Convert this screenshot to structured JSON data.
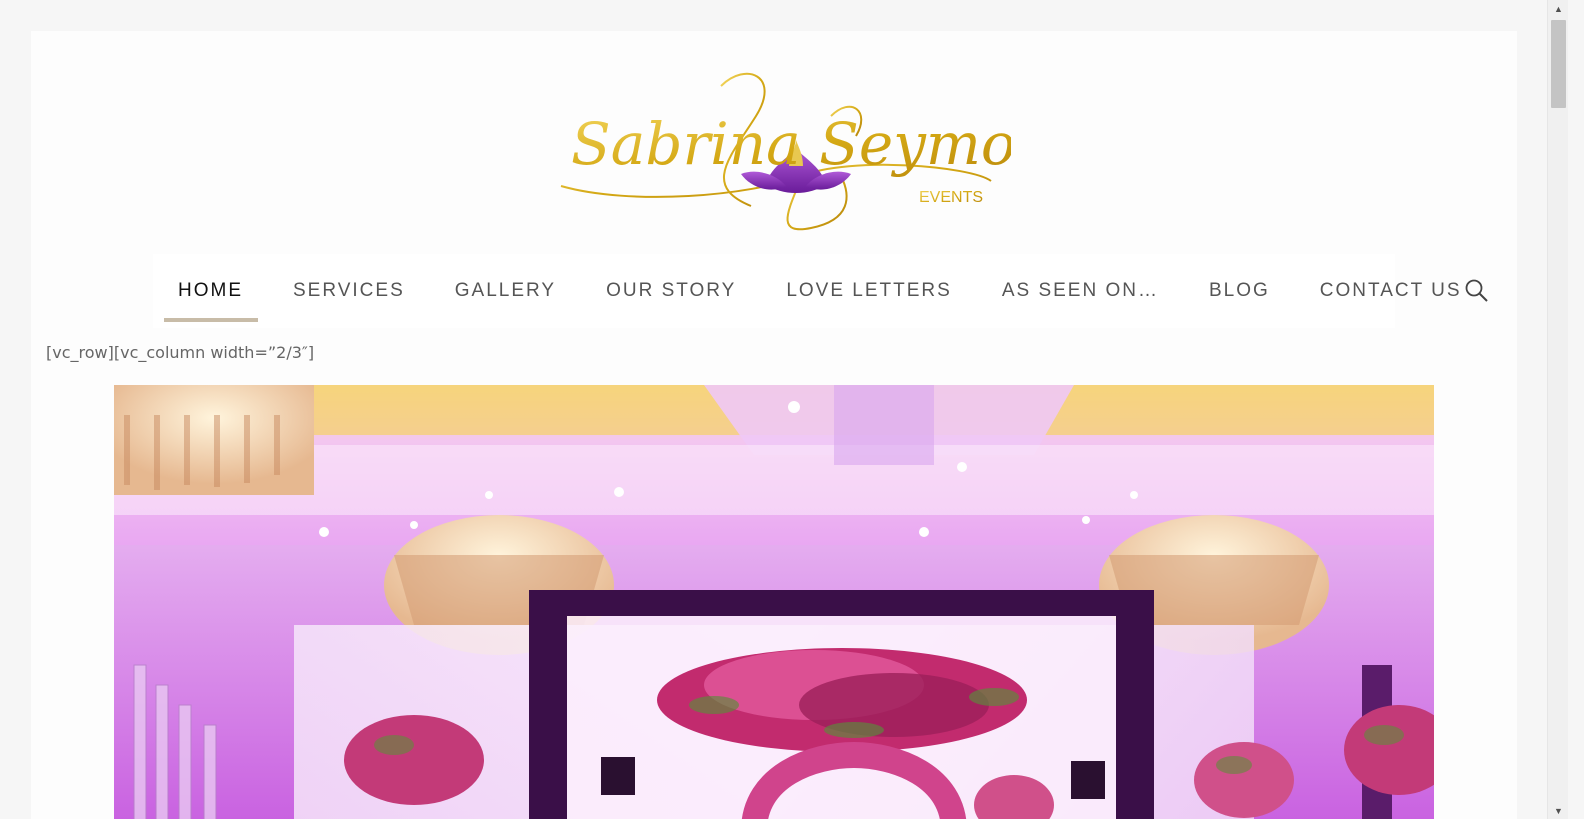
{
  "logo": {
    "script_text": "Sabrina Seymore",
    "sub_text": "EVENTS"
  },
  "nav": {
    "items": [
      {
        "label": "HOME",
        "active": true
      },
      {
        "label": "SERVICES"
      },
      {
        "label": "GALLERY"
      },
      {
        "label": "OUR STORY"
      },
      {
        "label": "LOVE LETTERS"
      },
      {
        "label": "AS SEEN ON…"
      },
      {
        "label": "BLOG"
      },
      {
        "label": "CONTACT US"
      }
    ],
    "search_icon": "search-icon"
  },
  "content": {
    "shortcode_text": "[vc_row][vc_column width=”2/3″]"
  },
  "colors": {
    "page_bg": "#f6f6f6",
    "nav_active_underline": "#c8bca8",
    "logo_gold": "#d4a814",
    "logo_purple": "#8a2bbf"
  },
  "scrollbar": {
    "up_icon": "scroll-up-arrow-icon",
    "down_icon": "scroll-down-arrow-icon"
  }
}
